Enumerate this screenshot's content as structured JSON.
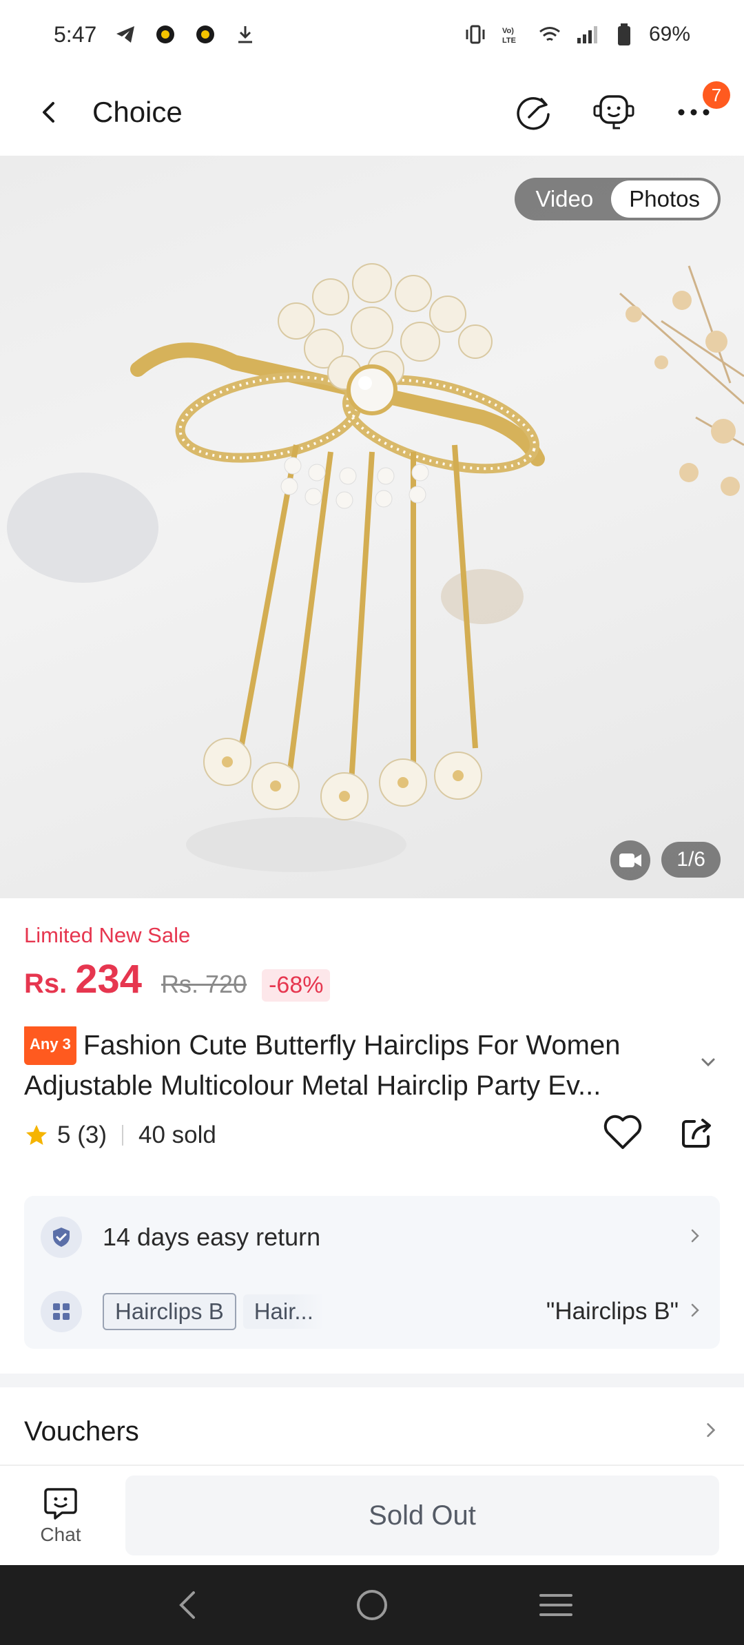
{
  "status_bar": {
    "time": "5:47",
    "battery": "69%",
    "left_icons": [
      "telegram-icon",
      "notification-app-icon",
      "notification-app-icon",
      "download-icon"
    ],
    "right_icons": [
      "vibrate-icon",
      "volte-icon",
      "wifi-icon",
      "signal-icon",
      "battery-icon"
    ]
  },
  "header": {
    "title": "Choice",
    "cart_badge": "7",
    "icons": [
      "back-icon",
      "history-icon",
      "customer-service-icon",
      "more-icon"
    ]
  },
  "gallery": {
    "toggle": {
      "video_label": "Video",
      "photos_label": "Photos",
      "active": "Photos"
    },
    "page_indicator": "1/6"
  },
  "price": {
    "sale_label": "Limited New Sale",
    "currency": "Rs.",
    "current": "234",
    "original": "Rs. 720",
    "discount": "-68%"
  },
  "product": {
    "badge": "Any 3",
    "title_line1": "Fashion Cute Butterfly Hairclips For Women",
    "title_line2": "Adjustable Multicolour Metal Hairclip Party Ev..."
  },
  "rating": {
    "score": "5",
    "count": "(3)",
    "sold": "40 sold"
  },
  "info": {
    "return_text": "14 days easy return",
    "variant_chip_1": "Hairclips B",
    "variant_chip_2": "Hair...",
    "variant_selected": "\"Hairclips B\""
  },
  "vouchers": {
    "title": "Vouchers"
  },
  "bottom": {
    "chat_label": "Chat",
    "sold_out_label": "Sold Out"
  },
  "colors": {
    "price_red": "#e6364f",
    "badge_orange": "#ff5a1f",
    "card_bg": "#f5f7fa"
  }
}
